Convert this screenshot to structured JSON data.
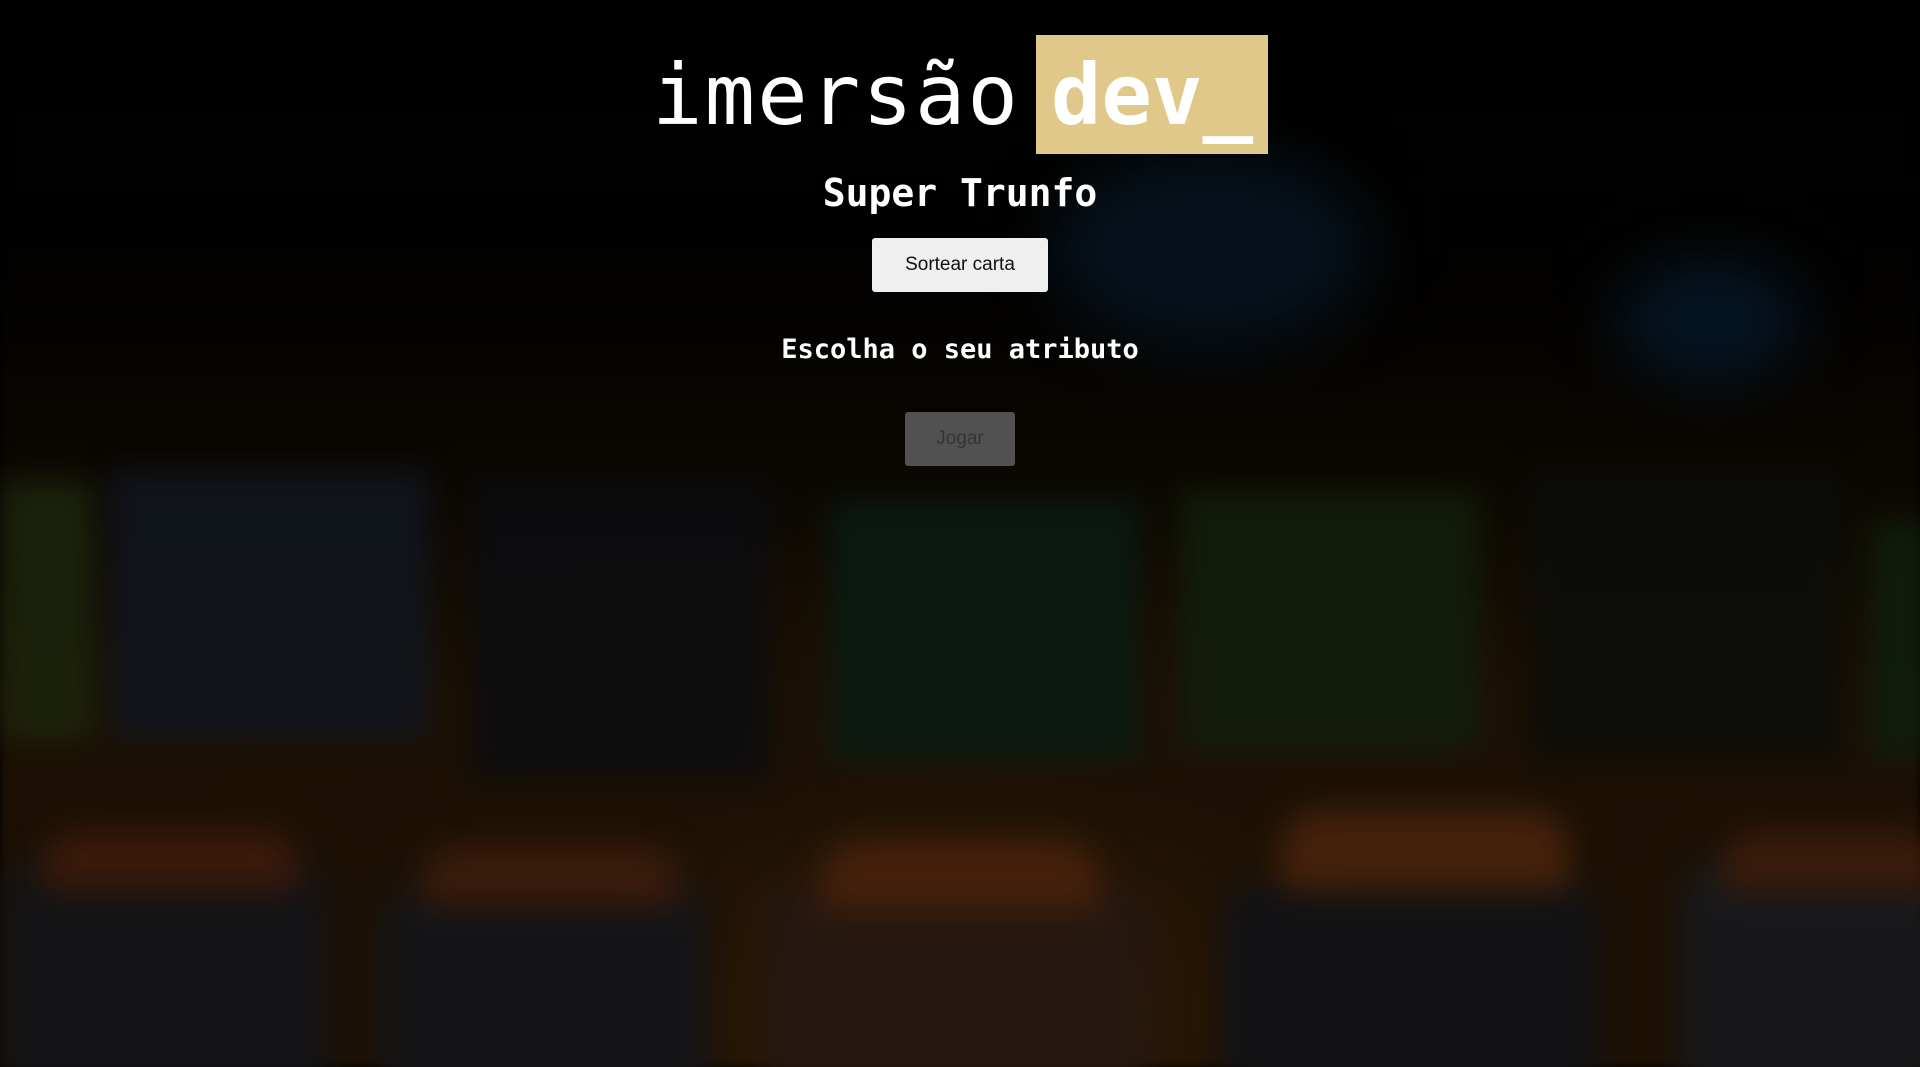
{
  "header": {
    "logo_text": "imersão",
    "logo_highlight": "dev_",
    "logo_highlight_color": "#dfc88a"
  },
  "game": {
    "title": "Super Trunfo",
    "draw_button_label": "Sortear carta",
    "attribute_prompt": "Escolha o seu atributo",
    "play_button_label": "Jogar",
    "play_button_disabled": true
  }
}
